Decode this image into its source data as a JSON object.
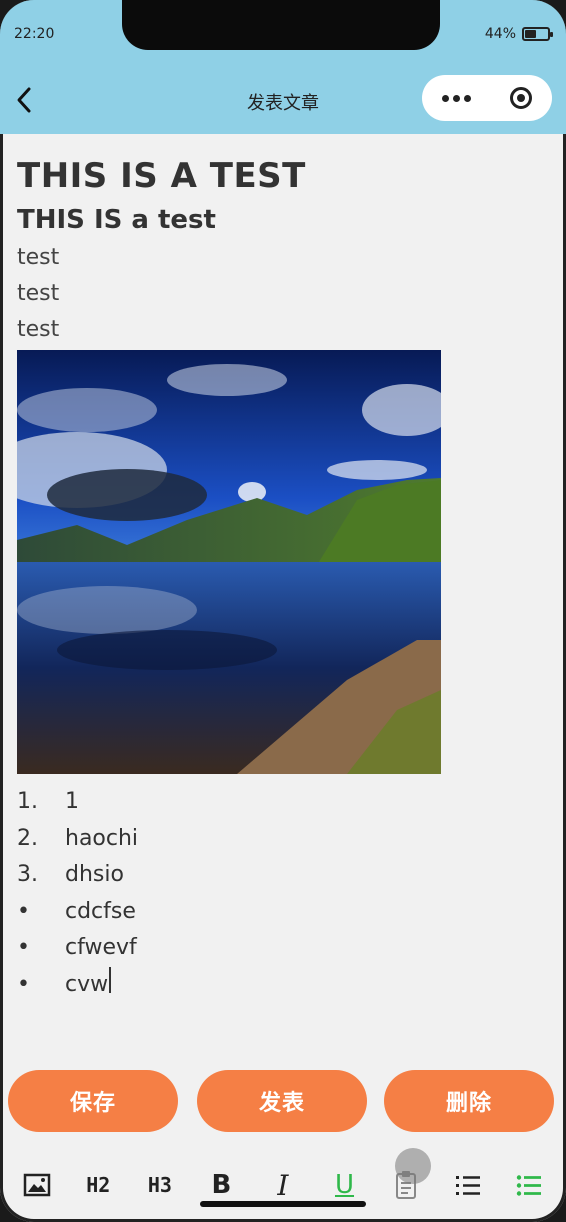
{
  "status_bar": {
    "time": "22:20",
    "battery": "44%",
    "battery_level": 0.44
  },
  "navbar": {
    "title": "发表文章",
    "back_icon": "chevron-left-icon",
    "more_icon": "more-dots-icon",
    "close_icon": "record-icon"
  },
  "article": {
    "heading1": "THIS IS A TEST",
    "heading2": "THIS IS a test",
    "paragraphs": [
      "test",
      "test",
      "test"
    ],
    "image_icon": "landscape-photo",
    "ordered_list": [
      {
        "marker": "1.",
        "text": "1"
      },
      {
        "marker": "2.",
        "text": "haochi"
      },
      {
        "marker": "3.",
        "text": "dhsio"
      }
    ],
    "bullet_list": [
      {
        "marker": "•",
        "text": "cdcfse"
      },
      {
        "marker": "•",
        "text": "cfwevf"
      },
      {
        "marker": "•",
        "text": "cvw"
      }
    ]
  },
  "actions": {
    "save": "保存",
    "publish": "发表",
    "delete": "删除",
    "color": "#f57f45"
  },
  "toolbar": {
    "image_icon": "image-icon",
    "h2": "H2",
    "h3": "H3",
    "bold": "B",
    "italic": "I",
    "underline": "U",
    "clipboard_icon": "clipboard-icon",
    "ordered_list_icon": "ordered-list-icon",
    "bullet_list_icon": "bullet-list-icon",
    "active_color": "#2fb84a"
  }
}
